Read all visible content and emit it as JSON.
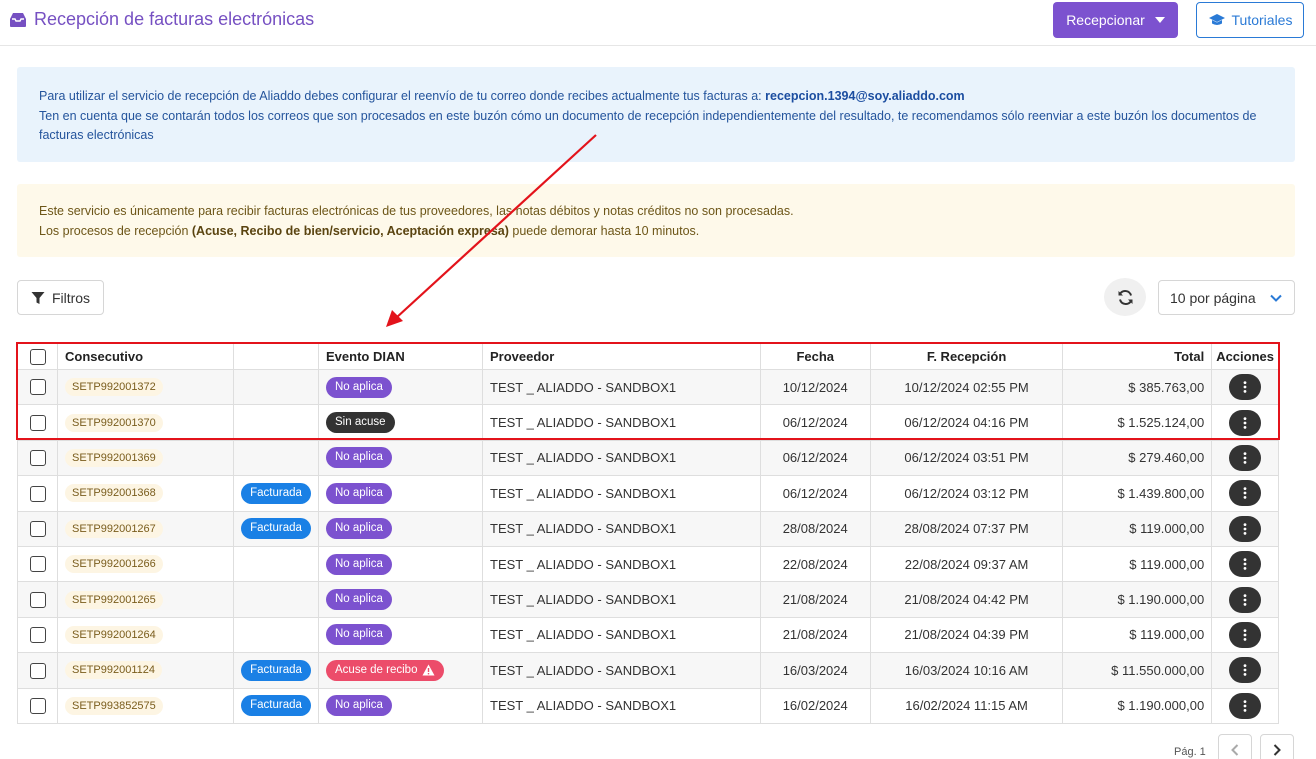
{
  "header": {
    "title": "Recepción de facturas electrónicas",
    "primary_button": "Recepcionar",
    "tutorials_button": "Tutoriales"
  },
  "info_blue": {
    "line1_text": "Para utilizar el servicio de recepción de Aliaddo debes configurar el reenvío de tu correo donde recibes actualmente tus facturas a: ",
    "email": "recepcion.1394@soy.aliaddo.com",
    "line2_text": "Ten en cuenta que se contarán todos los correos que son procesados en este buzón cómo un documento de recepción independientemente del resultado, te recomendamos sólo reenviar a este buzón los documentos de facturas electrónicas"
  },
  "info_yellow": {
    "line1_text": "Este servicio es únicamente para recibir facturas electrónicas de tus proveedores, las notas débitos y notas créditos no son procesadas.",
    "line2_prefix": "Los procesos de recepción ",
    "line2_bold": "(Acuse, Recibo de bien/servicio, Aceptación expresa)",
    "line2_suffix": " puede demorar hasta 10 minutos."
  },
  "toolbar": {
    "filter_label": "Filtros",
    "per_page_label": "10 por página"
  },
  "table": {
    "columns": {
      "consecutivo": "Consecutivo",
      "facturada": "",
      "evento": "Evento DIAN",
      "proveedor": "Proveedor",
      "fecha": "Fecha",
      "frecepcion": "F. Recepción",
      "total": "Total",
      "acciones": "Acciones"
    },
    "rows": [
      {
        "consecutivo": "SETP992001372",
        "facturada": "",
        "evento": "No aplica",
        "evento_style": "purple",
        "proveedor": "TEST _ ALIADDO - SANDBOX1",
        "fecha": "10/12/2024",
        "frecepcion": "10/12/2024 02:55 PM",
        "total": "$ 385.763,00"
      },
      {
        "consecutivo": "SETP992001370",
        "facturada": "",
        "evento": "Sin acuse",
        "evento_style": "dark",
        "proveedor": "TEST _ ALIADDO - SANDBOX1",
        "fecha": "06/12/2024",
        "frecepcion": "06/12/2024 04:16 PM",
        "total": "$ 1.525.124,00"
      },
      {
        "consecutivo": "SETP992001369",
        "facturada": "",
        "evento": "No aplica",
        "evento_style": "purple",
        "proveedor": "TEST _ ALIADDO - SANDBOX1",
        "fecha": "06/12/2024",
        "frecepcion": "06/12/2024 03:51 PM",
        "total": "$ 279.460,00"
      },
      {
        "consecutivo": "SETP992001368",
        "facturada": "Facturada",
        "evento": "No aplica",
        "evento_style": "purple",
        "proveedor": "TEST _ ALIADDO - SANDBOX1",
        "fecha": "06/12/2024",
        "frecepcion": "06/12/2024 03:12 PM",
        "total": "$ 1.439.800,00"
      },
      {
        "consecutivo": "SETP992001267",
        "facturada": "Facturada",
        "evento": "No aplica",
        "evento_style": "purple",
        "proveedor": "TEST _ ALIADDO - SANDBOX1",
        "fecha": "28/08/2024",
        "frecepcion": "28/08/2024 07:37 PM",
        "total": "$ 119.000,00"
      },
      {
        "consecutivo": "SETP992001266",
        "facturada": "",
        "evento": "No aplica",
        "evento_style": "purple",
        "proveedor": "TEST _ ALIADDO - SANDBOX1",
        "fecha": "22/08/2024",
        "frecepcion": "22/08/2024 09:37 AM",
        "total": "$ 119.000,00"
      },
      {
        "consecutivo": "SETP992001265",
        "facturada": "",
        "evento": "No aplica",
        "evento_style": "purple",
        "proveedor": "TEST _ ALIADDO - SANDBOX1",
        "fecha": "21/08/2024",
        "frecepcion": "21/08/2024 04:42 PM",
        "total": "$ 1.190.000,00"
      },
      {
        "consecutivo": "SETP992001264",
        "facturada": "",
        "evento": "No aplica",
        "evento_style": "purple",
        "proveedor": "TEST _ ALIADDO - SANDBOX1",
        "fecha": "21/08/2024",
        "frecepcion": "21/08/2024 04:39 PM",
        "total": "$ 119.000,00"
      },
      {
        "consecutivo": "SETP992001124",
        "facturada": "Facturada",
        "evento": "Acuse de recibo",
        "evento_style": "red",
        "proveedor": "TEST _ ALIADDO - SANDBOX1",
        "fecha": "16/03/2024",
        "frecepcion": "16/03/2024 10:16 AM",
        "total": "$ 11.550.000,00"
      },
      {
        "consecutivo": "SETP993852575",
        "facturada": "Facturada",
        "evento": "No aplica",
        "evento_style": "purple",
        "proveedor": "TEST _ ALIADDO - SANDBOX1",
        "fecha": "16/02/2024",
        "frecepcion": "16/02/2024 11:15 AM",
        "total": "$ 1.190.000,00"
      }
    ]
  },
  "pager": {
    "label": "Pág. 1"
  },
  "icons": {
    "title": "inbox-icon",
    "tutorials": "graduation-cap-icon",
    "filter": "filter-icon",
    "refresh": "refresh-icon",
    "per_page": "chevron-down-icon",
    "actions": "vertical-dots-icon",
    "warning": "warning-icon",
    "pager_prev": "chevron-left-icon",
    "pager_next": "chevron-right-icon"
  },
  "colors": {
    "brand_purple": "#7c52cf",
    "link_blue": "#2a7ad6",
    "highlight_red": "#e3131b",
    "badge_blue": "#1a80e5",
    "badge_red": "#ec4c6a",
    "badge_dark": "#333333"
  }
}
